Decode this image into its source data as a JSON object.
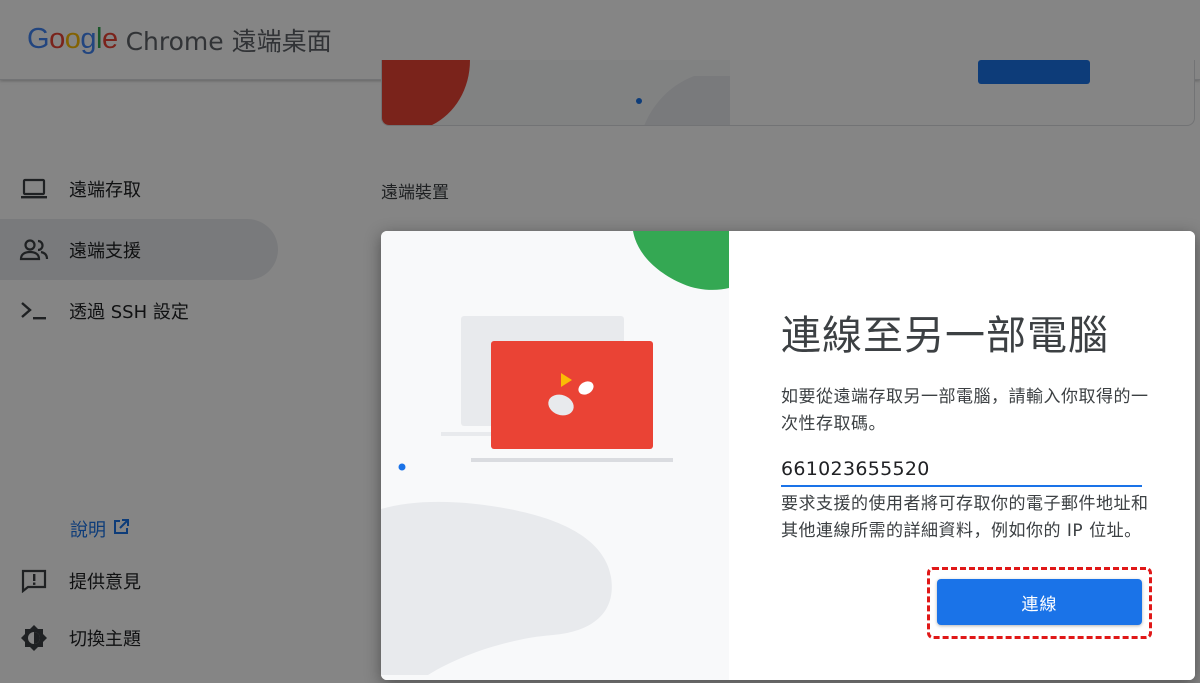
{
  "header": {
    "logo_letters": [
      {
        "char": "G",
        "color": "#4285F4"
      },
      {
        "char": "o",
        "color": "#EA4335"
      },
      {
        "char": "o",
        "color": "#FBBC05"
      },
      {
        "char": "g",
        "color": "#4285F4"
      },
      {
        "char": "l",
        "color": "#34A853"
      },
      {
        "char": "e",
        "color": "#EA4335"
      }
    ],
    "product_name": "Chrome 遠端桌面"
  },
  "sidebar": {
    "items": [
      {
        "label": "遠端存取",
        "icon": "laptop-icon",
        "active": false
      },
      {
        "label": "遠端支援",
        "icon": "people-icon",
        "active": true
      },
      {
        "label": "透過 SSH 設定",
        "icon": "terminal-icon",
        "active": false
      }
    ],
    "help_label": "說明",
    "feedback_label": "提供意見",
    "theme_label": "切換主題"
  },
  "main": {
    "section_label": "遠端裝置"
  },
  "dialog": {
    "title": "連線至另一部電腦",
    "description": "如要從遠端存取另一部電腦，請輸入你取得的一次性存取碼。",
    "access_code_value": "661023655520",
    "note": "要求支援的使用者將可存取你的電子郵件地址和其他連線所需的詳細資料，例如你的 IP 位址。",
    "connect_label": "連線"
  },
  "colors": {
    "accent": "#1a73e8",
    "illustration_red": "#ea4335",
    "illustration_green": "#34a853",
    "illustration_yellow": "#fbbc05",
    "highlight": "#e01818"
  }
}
